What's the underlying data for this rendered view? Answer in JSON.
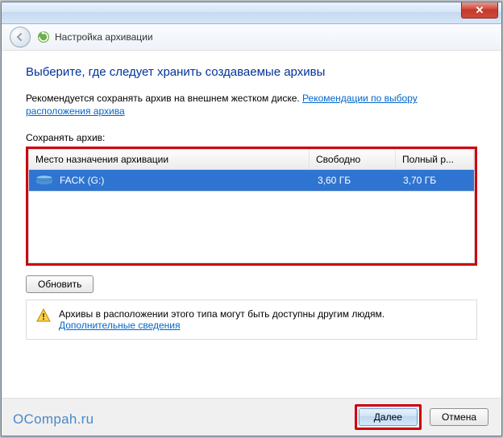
{
  "titlebar": {
    "close_glyph": "✕"
  },
  "header": {
    "title": "Настройка архивации"
  },
  "main": {
    "heading": "Выберите, где следует хранить создаваемые архивы",
    "intro_prefix": "Рекомендуется сохранять архив на внешнем жестком диске. ",
    "intro_link": "Рекомендации по выбору расположения архива",
    "save_label": "Сохранять архив:",
    "columns": {
      "dest": "Место назначения архивации",
      "free": "Свободно",
      "total": "Полный р..."
    },
    "rows": [
      {
        "name": "FACK (G:)",
        "free": "3,60 ГБ",
        "total": "3,70 ГБ"
      }
    ],
    "refresh_label": "Обновить",
    "warning_text": "Архивы в расположении этого типа могут быть доступны другим людям.",
    "warning_link": "Дополнительные сведения"
  },
  "footer": {
    "watermark": "OCompah.ru",
    "next_label": "Далее",
    "cancel_label": "Отмена"
  }
}
